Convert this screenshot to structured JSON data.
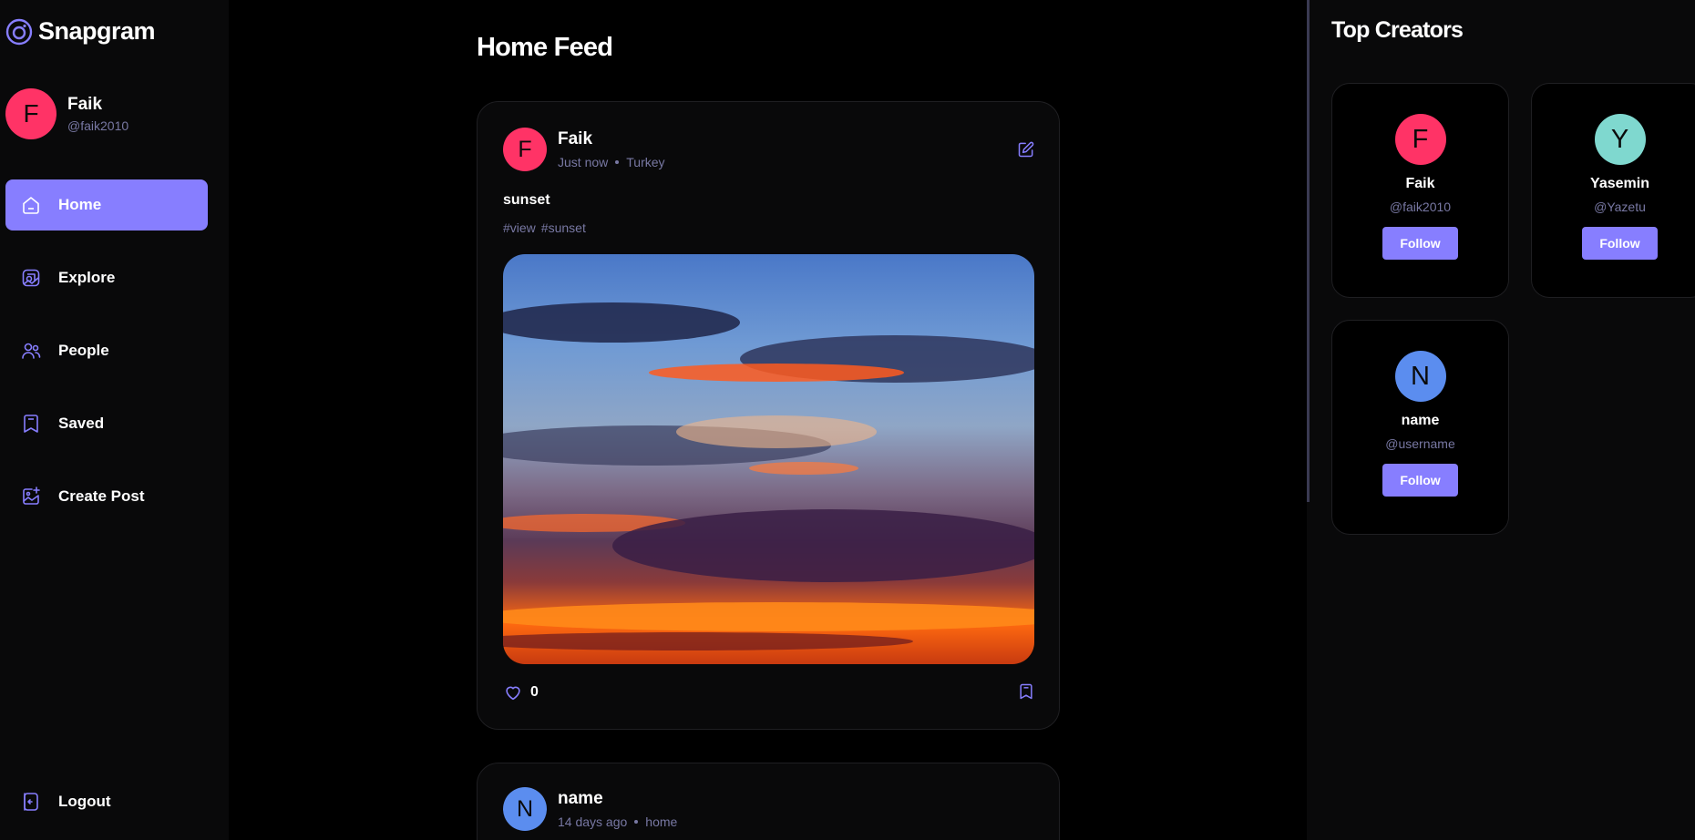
{
  "app": {
    "name": "Snapgram",
    "logo_icon": "snapgram-logo-icon"
  },
  "colors": {
    "accent": "#877eff",
    "muted": "#7878a3",
    "background": "#000000",
    "surface": "#09090a"
  },
  "user": {
    "initial": "F",
    "name": "Faik",
    "handle": "@faik2010",
    "avatar_color": "#ff3366"
  },
  "nav": {
    "items": [
      {
        "label": "Home",
        "icon": "home-icon",
        "active": true
      },
      {
        "label": "Explore",
        "icon": "explore-icon",
        "active": false
      },
      {
        "label": "People",
        "icon": "people-icon",
        "active": false
      },
      {
        "label": "Saved",
        "icon": "bookmark-icon",
        "active": false
      },
      {
        "label": "Create Post",
        "icon": "create-post-icon",
        "active": false
      }
    ],
    "logout": "Logout"
  },
  "feed": {
    "title": "Home Feed",
    "posts": [
      {
        "author_initial": "F",
        "author": "Faik",
        "avatar_color": "#ff3366",
        "time": "Just now",
        "location": "Turkey",
        "caption": "sunset",
        "tags": [
          "#view",
          "#sunset"
        ],
        "likes": "0"
      },
      {
        "author_initial": "N",
        "author": "name",
        "avatar_color": "#5b8def",
        "time": "14 days ago",
        "location": "home"
      }
    ]
  },
  "top_creators": {
    "title": "Top Creators",
    "follow_label": "Follow",
    "creators": [
      {
        "initial": "F",
        "name": "Faik",
        "handle": "@faik2010",
        "avatar_color": "#ff3366"
      },
      {
        "initial": "Y",
        "name": "Yasemin",
        "handle": "@Yazetu",
        "avatar_color": "#7fd8cf"
      },
      {
        "initial": "N",
        "name": "name",
        "handle": "@username",
        "avatar_color": "#5b8def"
      }
    ]
  }
}
